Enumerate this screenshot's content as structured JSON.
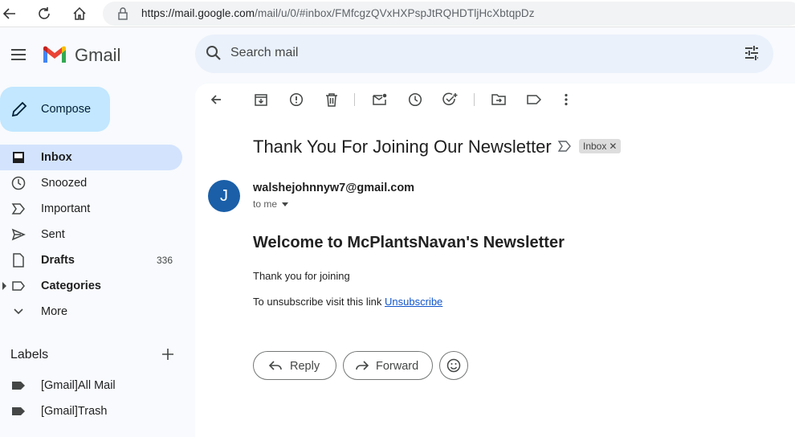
{
  "browser": {
    "url_host": "https://mail.google.com",
    "url_path": "/mail/u/0/#inbox/FMfcgzQVxHXPspJtRQHDTljHcXbtqpDz"
  },
  "app": {
    "name": "Gmail"
  },
  "search": {
    "placeholder": "Search mail"
  },
  "compose": {
    "label": "Compose"
  },
  "nav": [
    {
      "label": "Inbox",
      "icon": "inbox-icon",
      "active": true
    },
    {
      "label": "Snoozed",
      "icon": "clock-icon"
    },
    {
      "label": "Important",
      "icon": "important-icon"
    },
    {
      "label": "Sent",
      "icon": "send-icon"
    },
    {
      "label": "Drafts",
      "icon": "draft-icon",
      "count": "336"
    },
    {
      "label": "Categories",
      "icon": "label-outline-icon"
    },
    {
      "label": "More",
      "icon": "chevron-down-icon"
    }
  ],
  "labels": {
    "title": "Labels",
    "items": [
      {
        "label": "[Gmail]All Mail"
      },
      {
        "label": "[Gmail]Trash"
      }
    ]
  },
  "message": {
    "subject": "Thank You For Joining Our Newsletter",
    "chip": "Inbox",
    "avatar_letter": "J",
    "sender": "walshejohnnyw7@gmail.com",
    "to": "to me",
    "heading": "Welcome to McPlantsNavan's Newsletter",
    "para1": "Thank you for joining",
    "para2": "To unsubscribe visit this link",
    "link": "Unsubscribe"
  },
  "actions": {
    "reply": "Reply",
    "forward": "Forward"
  },
  "colors": {
    "accent": "#c2e7ff",
    "active_nav": "#d3e3fd",
    "avatar": "#1a5fa8",
    "link": "#1155cc"
  }
}
